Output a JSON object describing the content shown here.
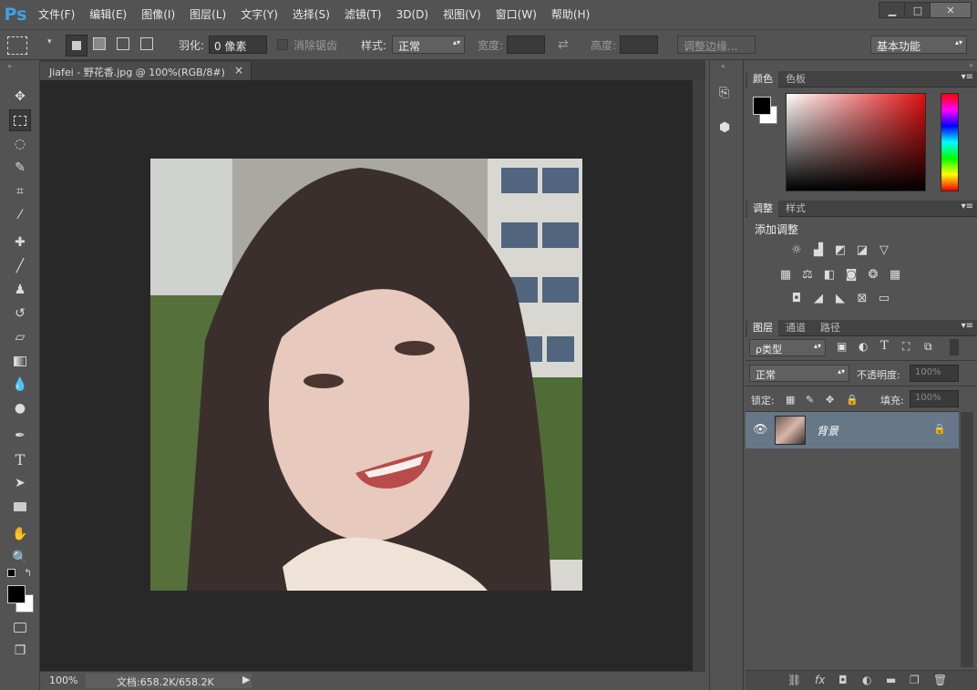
{
  "app": {
    "logo": "Ps"
  },
  "menu": [
    "文件(F)",
    "编辑(E)",
    "图像(I)",
    "图层(L)",
    "文字(Y)",
    "选择(S)",
    "滤镜(T)",
    "3D(D)",
    "视图(V)",
    "窗口(W)",
    "帮助(H)"
  ],
  "window_controls": {
    "minimize": "▁",
    "maximize": "□",
    "close": "✕"
  },
  "options": {
    "feather_label": "羽化:",
    "feather_value": "0 像素",
    "antialias_label": "消除锯齿",
    "style_label": "样式:",
    "style_value": "正常",
    "width_label": "宽度:",
    "height_label": "高度:",
    "refine_edge": "调整边缘...",
    "workspace": "基本功能"
  },
  "document": {
    "tab_title": "Jiafei - 野花香.jpg @ 100%(RGB/8#)",
    "tab_close": "×"
  },
  "status": {
    "zoom": "100%",
    "doc_info": "文档:658.2K/658.2K"
  },
  "color_panel": {
    "tabs": [
      "颜色",
      "色板"
    ],
    "foreground": "#000000",
    "background": "#ffffff"
  },
  "adjustments_panel": {
    "tabs": [
      "调整",
      "样式"
    ],
    "title": "添加调整"
  },
  "layers_panel": {
    "tabs": [
      "图层",
      "通道",
      "路径"
    ],
    "filter_label": "ρ类型",
    "blend_mode": "正常",
    "opacity_label": "不透明度:",
    "opacity_value": "100%",
    "lock_label": "锁定:",
    "fill_label": "填充:",
    "fill_value": "100%",
    "layers": [
      {
        "name": "背景",
        "visible": true,
        "locked": true
      }
    ]
  },
  "icons": {
    "accent": "#3fa1e6",
    "layer_selected": "#667788"
  }
}
